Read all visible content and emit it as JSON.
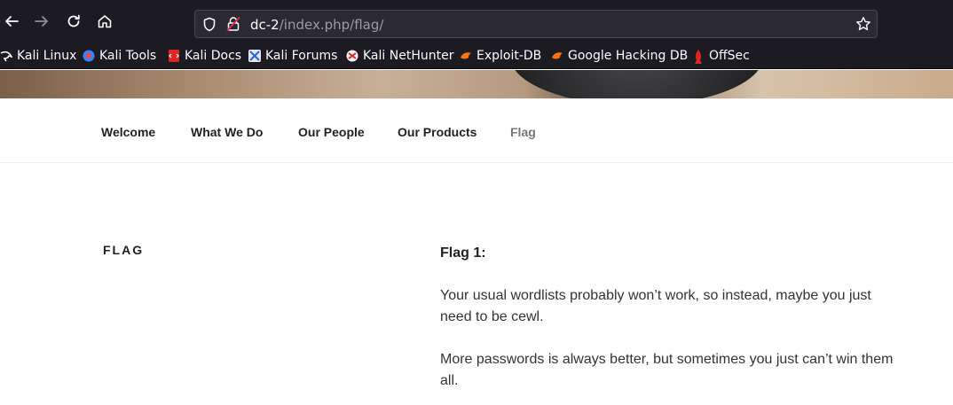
{
  "browser": {
    "url_host": "dc-2",
    "url_path": "/index.php/flag/",
    "bookmarks": [
      {
        "label": "Kali Linux",
        "icon": "kali-dragon-icon"
      },
      {
        "label": "Kali Tools",
        "icon": "kali-tools-icon"
      },
      {
        "label": "Kali Docs",
        "icon": "kali-docs-icon"
      },
      {
        "label": "Kali Forums",
        "icon": "kali-forums-icon"
      },
      {
        "label": "Kali NetHunter",
        "icon": "kali-nethunter-icon"
      },
      {
        "label": "Exploit-DB",
        "icon": "exploit-db-icon"
      },
      {
        "label": "Google Hacking DB",
        "icon": "ghdb-icon"
      },
      {
        "label": "OffSec",
        "icon": "offsec-icon"
      }
    ]
  },
  "site_nav": {
    "items": [
      {
        "label": "Welcome"
      },
      {
        "label": "What We Do"
      },
      {
        "label": "Our People"
      },
      {
        "label": "Our Products"
      },
      {
        "label": "Flag"
      }
    ]
  },
  "content": {
    "page_title": "FLAG",
    "heading": "Flag 1:",
    "paragraphs": [
      "Your usual wordlists probably won’t work, so instead, maybe you just need to be cewl.",
      "More passwords is always better, but sometimes you just can’t win them all."
    ]
  }
}
